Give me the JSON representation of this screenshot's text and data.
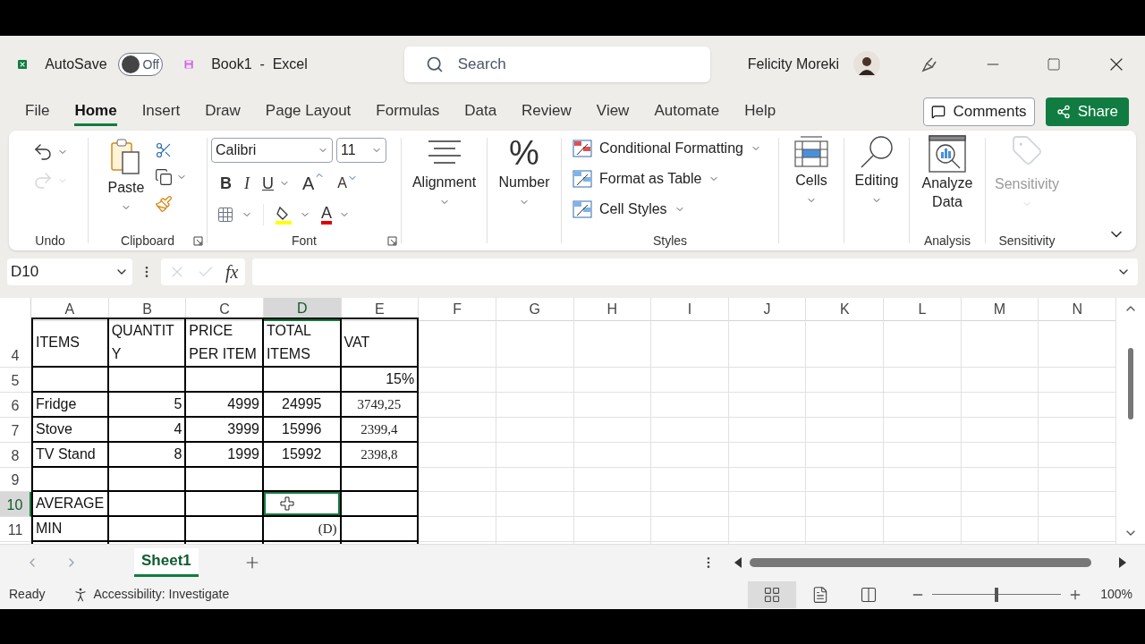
{
  "title_bar": {
    "autosave_label": "AutoSave",
    "autosave": {
      "on": false,
      "label": "Off"
    },
    "document_title": "Book1  -  Excel",
    "search": {
      "placeholder": "Search"
    },
    "user_name": "Felicity Moreki"
  },
  "tabs": [
    {
      "label": "File",
      "selected": false
    },
    {
      "label": "Home",
      "selected": true
    },
    {
      "label": "Insert",
      "selected": false
    },
    {
      "label": "Draw",
      "selected": false
    },
    {
      "label": "Page Layout",
      "selected": false
    },
    {
      "label": "Formulas",
      "selected": false
    },
    {
      "label": "Data",
      "selected": false
    },
    {
      "label": "Review",
      "selected": false
    },
    {
      "label": "View",
      "selected": false
    },
    {
      "label": "Automate",
      "selected": false
    },
    {
      "label": "Help",
      "selected": false
    }
  ],
  "comments_button": "Comments",
  "share_button": "Share",
  "ribbon": {
    "undo": {
      "label": "Undo"
    },
    "clipboard": {
      "label": "Clipboard",
      "paste": "Paste"
    },
    "font": {
      "label": "Font",
      "font_name": "Calibri",
      "font_size": "11",
      "bold": "B",
      "italic": "I",
      "underline": "U",
      "grow": "A",
      "shrink": "A",
      "font_color": "A"
    },
    "alignment": {
      "label": "Alignment"
    },
    "number": {
      "label": "Number",
      "symbol": "%"
    },
    "styles": {
      "label": "Styles",
      "items": [
        "Conditional Formatting",
        "Format as Table",
        "Cell Styles"
      ]
    },
    "cells": {
      "label": "Cells"
    },
    "editing": {
      "label": "Editing"
    },
    "analysis": {
      "label": "Analysis",
      "button": "Analyze Data"
    },
    "sensitivity": {
      "label": "Sensitivity",
      "button": "Sensitivity",
      "disabled": true
    }
  },
  "formula_bar": {
    "name_box": "D10",
    "fx": "fx"
  },
  "sheet": {
    "columns": [
      {
        "label": "A",
        "selected": false
      },
      {
        "label": "B",
        "selected": false
      },
      {
        "label": "C",
        "selected": false
      },
      {
        "label": "D",
        "selected": true
      },
      {
        "label": "E",
        "selected": false
      },
      {
        "label": "F",
        "selected": false
      },
      {
        "label": "G",
        "selected": false
      },
      {
        "label": "H",
        "selected": false
      },
      {
        "label": "I",
        "selected": false
      },
      {
        "label": "J",
        "selected": false
      },
      {
        "label": "K",
        "selected": false
      },
      {
        "label": "L",
        "selected": false
      },
      {
        "label": "M",
        "selected": false
      },
      {
        "label": "N",
        "selected": false
      }
    ],
    "rows": [
      {
        "label": "4",
        "selected": false,
        "cells": [
          {
            "text": "ITEMS",
            "kind": "heading",
            "selected": false
          },
          {
            "text": "QUANTITY",
            "kind": "heading",
            "selected": false
          },
          {
            "text": "PRICE PER ITEM",
            "kind": "heading",
            "selected": false
          },
          {
            "text": "TOTAL ITEMS",
            "kind": "heading",
            "selected": false
          },
          {
            "text": "VAT",
            "kind": "heading",
            "selected": false
          }
        ]
      },
      {
        "label": "5",
        "selected": false,
        "cells": [
          {
            "selected": false
          },
          {
            "selected": false
          },
          {
            "selected": false
          },
          {
            "selected": false
          },
          {
            "text": "15%",
            "kind": "number",
            "selected": false
          }
        ]
      },
      {
        "label": "6",
        "selected": false,
        "cells": [
          {
            "text": "Fridge",
            "kind": "label",
            "selected": false
          },
          {
            "text": "5",
            "kind": "number",
            "selected": false
          },
          {
            "text": "4999",
            "kind": "number",
            "selected": false
          },
          {
            "text": "24995",
            "kind": "centered",
            "selected": false
          },
          {
            "text": "3749,25",
            "kind": "serif_centered",
            "selected": false
          }
        ]
      },
      {
        "label": "7",
        "selected": false,
        "cells": [
          {
            "text": "Stove",
            "kind": "label",
            "selected": false
          },
          {
            "text": "4",
            "kind": "number",
            "selected": false
          },
          {
            "text": "3999",
            "kind": "number",
            "selected": false
          },
          {
            "text": "15996",
            "kind": "centered",
            "selected": false
          },
          {
            "text": "2399,4",
            "kind": "serif_centered",
            "selected": false
          }
        ]
      },
      {
        "label": "8",
        "selected": false,
        "cells": [
          {
            "text": "TV Stand",
            "kind": "label",
            "selected": false
          },
          {
            "text": "8",
            "kind": "number",
            "selected": false
          },
          {
            "text": "1999",
            "kind": "number",
            "selected": false
          },
          {
            "text": "15992",
            "kind": "centered",
            "selected": false
          },
          {
            "text": "2398,8",
            "kind": "serif_centered",
            "selected": false
          }
        ]
      },
      {
        "label": "9",
        "selected": false,
        "cells": [
          {
            "selected": false
          },
          {
            "selected": false
          },
          {
            "selected": false
          },
          {
            "selected": false
          },
          {
            "selected": false
          }
        ]
      },
      {
        "label": "10",
        "selected": true,
        "cells": [
          {
            "text": "AVERAGE",
            "kind": "label",
            "selected": false
          },
          {
            "selected": false
          },
          {
            "selected": false
          },
          {
            "selected": true
          },
          {
            "selected": false
          }
        ]
      },
      {
        "label": "11",
        "selected": false,
        "cells": [
          {
            "text": "MIN",
            "kind": "label",
            "selected": false
          },
          {
            "selected": false
          },
          {
            "selected": false
          },
          {
            "text": "(D)",
            "kind": "serif_number",
            "selected": false
          },
          {
            "selected": false
          }
        ]
      }
    ]
  },
  "sheet_tabs": [
    {
      "label": "Sheet1",
      "selected": true
    }
  ],
  "status_bar": {
    "status": "Ready",
    "accessibility": "Accessibility: Investigate",
    "views": [
      {
        "kind": "normal",
        "selected": true
      },
      {
        "kind": "page_layout",
        "selected": false
      },
      {
        "kind": "page_break",
        "selected": false
      }
    ],
    "zoom": {
      "level": 0.5,
      "label": "100%"
    }
  }
}
